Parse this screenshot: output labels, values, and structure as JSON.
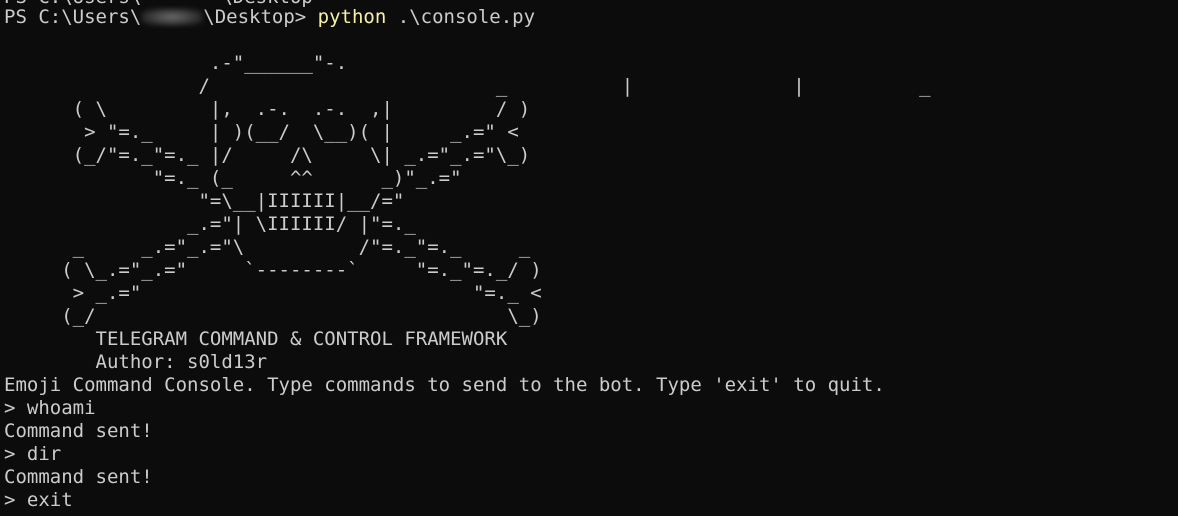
{
  "terminal": {
    "cut_top_line": "PS C:\\Users\\       \\Desktop",
    "prompt": {
      "prefix": "PS C:\\Users\\",
      "suffix": "\\Desktop> ",
      "command": "python",
      "argument": " .\\console.py"
    },
    "banner_art": "                  .-\"______\"-.\n                 /                         _          |              |          _\n      ( \\         |,  .-.  .-.  ,|         / )\n       > \"=._     | )(__/  \\__)( |     _.=\" <\n      (_/\"=._\"=._ |/     /\\     \\| _.=\"_.=\"\\_)\n             \"=._ (_     ^^      _)\"_.=\"\n                 \"=\\__|IIIIII|__/=\"\n                _.=\"| \\IIIIII/ |\"=._\n      _     _.=\"_.=\"\\          /\"=._\"=._     _\n     ( \\_.=\"_.=\"     `--------`     \"=._\"=._/ )\n      > _.=\"                             \"=._ <\n     (_/                                    \\_)",
    "title": "        TELEGRAM COMMAND & CONTROL FRAMEWORK",
    "author": "        Author: s0ld13r",
    "intro": "Emoji Command Console. Type commands to send to the bot. Type 'exit' to quit.",
    "history": [
      {
        "input": "> whoami",
        "output": "Command sent!"
      },
      {
        "input": "> dir",
        "output": "Command sent!"
      },
      {
        "input": "> exit"
      }
    ],
    "cut_bottom_line": "   .   .    .    .      .   .  .      ."
  }
}
